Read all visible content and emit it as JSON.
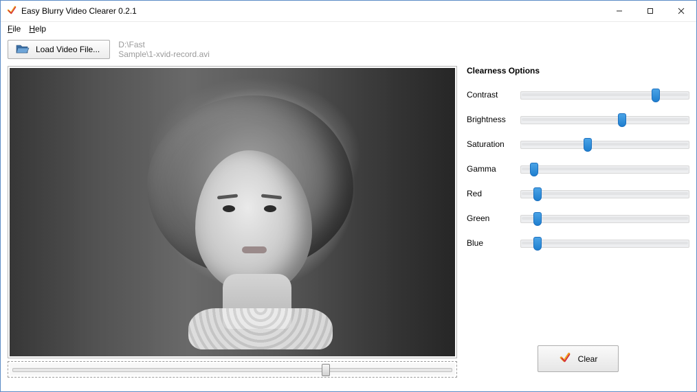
{
  "titlebar": {
    "title": "Easy Blurry Video Clearer 0.2.1"
  },
  "menubar": {
    "file": {
      "letter": "F",
      "rest": "ile"
    },
    "help": {
      "letter": "H",
      "rest": "elp"
    }
  },
  "toolbar": {
    "load_label": "Load Video File...",
    "path_line1": "D:\\Fast",
    "path_line2": "Sample\\1-xvid-record.avi"
  },
  "seek": {
    "percent": 71
  },
  "options": {
    "title": "Clearness Options",
    "sliders": [
      {
        "label": "Contrast",
        "percent": 80
      },
      {
        "label": "Brightness",
        "percent": 60
      },
      {
        "label": "Saturation",
        "percent": 40
      },
      {
        "label": "Gamma",
        "percent": 8
      },
      {
        "label": "Red",
        "percent": 10
      },
      {
        "label": "Green",
        "percent": 10
      },
      {
        "label": "Blue",
        "percent": 10
      }
    ],
    "clear_label": "Clear"
  }
}
